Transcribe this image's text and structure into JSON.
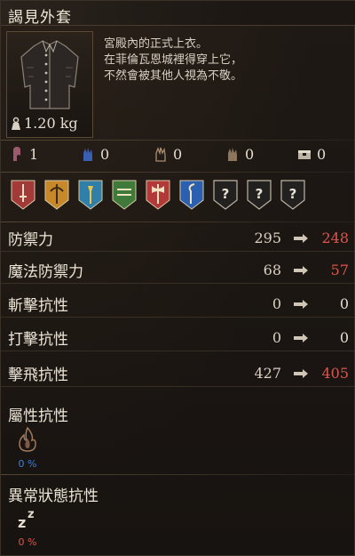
{
  "header": {
    "title": "謁見外套"
  },
  "item": {
    "description": [
      "宮殿內的正式上衣。",
      "在菲倫瓦恩城裡得穿上它，",
      "不然會被其他人視為不敬。"
    ],
    "weight": "1.20 kg"
  },
  "requirements": [
    {
      "icon": "strength-icon",
      "value": "1"
    },
    {
      "icon": "dexterity-icon",
      "value": "0"
    },
    {
      "icon": "intelligence-icon",
      "value": "0"
    },
    {
      "icon": "faith-icon",
      "value": "0"
    },
    {
      "icon": "chest-icon",
      "value": "0"
    }
  ],
  "slots": [
    {
      "icon": "sword-icon",
      "color": "#a33a3a"
    },
    {
      "icon": "staff-icon",
      "color": "#c7882a"
    },
    {
      "icon": "torch-icon",
      "color": "#2f7fa8"
    },
    {
      "icon": "dual-blade-icon",
      "color": "#3f7a3a"
    },
    {
      "icon": "axe-icon",
      "color": "#b33838"
    },
    {
      "icon": "hook-icon",
      "color": "#2b5fb0"
    },
    {
      "icon": "unknown-icon",
      "label": "?"
    },
    {
      "icon": "unknown-icon",
      "label": "?"
    },
    {
      "icon": "unknown-icon",
      "label": "?"
    }
  ],
  "stats": [
    {
      "label": "防禦力",
      "base": "295",
      "new": "248",
      "new_color": "#d9574e"
    },
    {
      "label": "魔法防禦力",
      "base": "68",
      "new": "57",
      "new_color": "#d9574e"
    },
    {
      "label": "斬擊抗性",
      "base": "0",
      "new": "0",
      "new_color": "#e4ddd0"
    },
    {
      "label": "打擊抗性",
      "base": "0",
      "new": "0",
      "new_color": "#e4ddd0"
    },
    {
      "label": "擊飛抗性",
      "base": "427",
      "new": "405",
      "new_color": "#d9574e"
    }
  ],
  "elemental": {
    "title": "屬性抗性",
    "items": [
      {
        "icon": "fire-icon",
        "value": "0 %",
        "color": "#3f7fd6"
      }
    ]
  },
  "status": {
    "title": "異常狀態抗性",
    "items": [
      {
        "icon": "sleep-icon",
        "value": "0 %",
        "color": "#d9574e"
      }
    ]
  },
  "colors": {
    "accent_red": "#d9574e",
    "accent_blue": "#3f7fd6",
    "text": "#e4ddd0",
    "background": "#1a1512"
  }
}
